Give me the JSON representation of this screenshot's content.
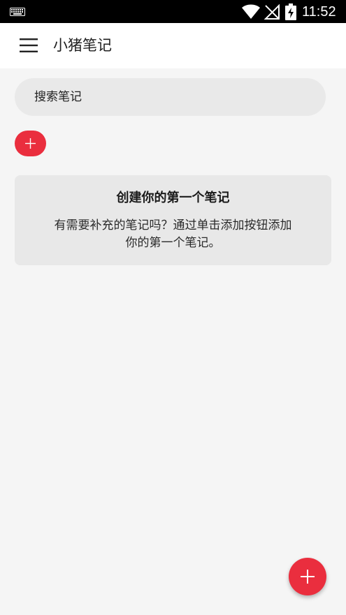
{
  "status_bar": {
    "time": "11:52",
    "icons": [
      "keyboard-icon",
      "wifi-icon",
      "no-signal-icon",
      "battery-charging-icon"
    ]
  },
  "app_bar": {
    "menu_icon": "hamburger-menu-icon",
    "title": "小猪笔记"
  },
  "search": {
    "placeholder": "搜索笔记"
  },
  "add_button": {
    "icon": "plus-icon"
  },
  "empty_state": {
    "title": "创建你的第一个笔记",
    "body": "有需要补充的笔记吗？通过单击添加按钮添加你的第一个笔记。"
  },
  "fab": {
    "icon": "plus-icon"
  },
  "colors": {
    "accent": "#ea2e3e",
    "status_bar": "#000000",
    "app_bar": "#ffffff",
    "background": "#f5f5f5",
    "search_bg": "#e9e9e9",
    "card_bg": "#e8e8e8"
  }
}
